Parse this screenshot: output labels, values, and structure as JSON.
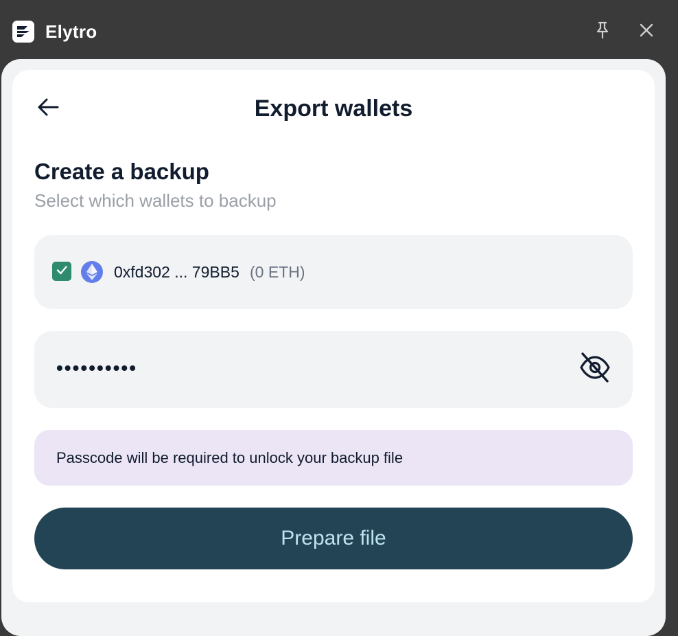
{
  "window": {
    "app_title": "Elytro",
    "logo_icon": "elytro-logo-icon",
    "pin_icon": "pin-icon",
    "close_icon": "close-icon"
  },
  "header": {
    "back_icon": "arrow-left-icon",
    "title": "Export wallets"
  },
  "section": {
    "title": "Create a backup",
    "subtitle": "Select which wallets to backup"
  },
  "wallets": [
    {
      "checked": true,
      "network_icon": "ethereum-icon",
      "address": "0xfd302 ... 79BB5",
      "balance": "(0 ETH)"
    }
  ],
  "passcode": {
    "value": "••••••••••",
    "visibility_icon": "eye-off-icon"
  },
  "notice": {
    "text": "Passcode will be required to unlock your backup file"
  },
  "actions": {
    "prepare_label": "Prepare file"
  },
  "colors": {
    "titlebar": "#3a3a3a",
    "panel": "#f1f3f5",
    "card": "#ffffff",
    "text_dark": "#111c2e",
    "text_muted": "#9aa0a6",
    "checkbox": "#2e8b6d",
    "ethereum": "#627eea",
    "notice_bg": "#ebe5f6",
    "primary_button": "#234454",
    "primary_button_text": "#bfe3ee"
  }
}
